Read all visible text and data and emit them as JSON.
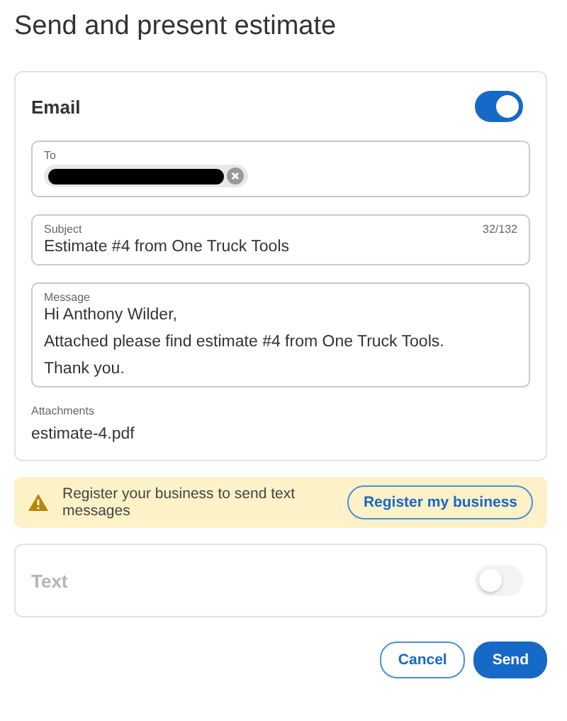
{
  "title": "Send and present estimate",
  "email": {
    "label": "Email",
    "on": true,
    "to": {
      "label": "To",
      "chips": [
        {
          "kind": "redacted"
        }
      ]
    },
    "subject": {
      "label": "Subject",
      "counter": "32/132",
      "value": "Estimate #4 from One Truck Tools"
    },
    "message": {
      "label": "Message",
      "paragraphs": [
        "Hi Anthony Wilder,",
        "Attached please find estimate #4 from One Truck Tools.",
        "Thank you."
      ]
    },
    "attachments": {
      "label": "Attachments",
      "files": [
        "estimate-4.pdf"
      ]
    }
  },
  "banner": {
    "message": "Register your business to send text messages",
    "button": "Register my business"
  },
  "text": {
    "label": "Text",
    "on": false,
    "disabled": true
  },
  "buttons": [
    {
      "label": "Cancel",
      "kind": "secondary"
    },
    {
      "label": "Send",
      "kind": "primary"
    }
  ]
}
